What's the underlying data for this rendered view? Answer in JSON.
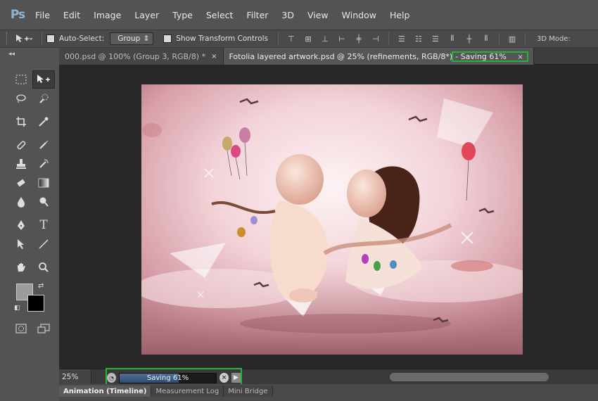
{
  "app": {
    "logo": "Ps"
  },
  "menu": [
    "File",
    "Edit",
    "Image",
    "Layer",
    "Type",
    "Select",
    "Filter",
    "3D",
    "View",
    "Window",
    "Help"
  ],
  "options": {
    "auto_select_label": "Auto-Select:",
    "auto_select_value": "Group",
    "transform_label": "Show Transform Controls",
    "mode_3d_label": "3D Mode:"
  },
  "tabs": [
    {
      "label": "000.psd @ 100% (Group 3, RGB/8) *",
      "close": "×"
    },
    {
      "label": "Fotolia layered artwork.psd @ 25% (refinements, RGB/8*)",
      "status": " - Saving 61%",
      "close": "×"
    }
  ],
  "status": {
    "zoom": "25%",
    "progress_label": "Saving 61%",
    "progress_fraction": 0.61
  },
  "bottom_tabs": [
    "Animation (Timeline)",
    "Measurement Log",
    "Mini Bridge"
  ],
  "colors": {
    "highlight": "#22b33a",
    "progress": "#3e5f86",
    "foreground": "#9c9c9c",
    "background": "#000000"
  },
  "icons": [
    "move-icon",
    "marquee-icon",
    "lasso-icon",
    "quick-select-icon",
    "crop-icon",
    "eyedropper-icon",
    "healing-icon",
    "brush-icon",
    "stamp-icon",
    "history-brush-icon",
    "eraser-icon",
    "gradient-icon",
    "blur-icon",
    "dodge-icon",
    "pen-icon",
    "type-icon",
    "path-select-icon",
    "line-icon",
    "hand-icon",
    "zoom-icon"
  ]
}
